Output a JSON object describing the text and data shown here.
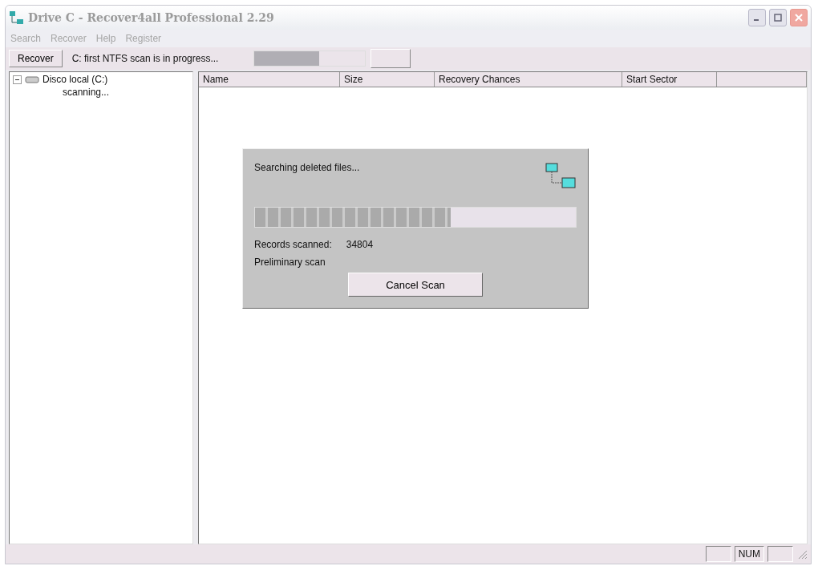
{
  "window": {
    "title": "Drive C  - Recover4all Professional 2.29"
  },
  "menu": [
    {
      "label": "Search",
      "disabled": true
    },
    {
      "label": "Recover",
      "disabled": true
    },
    {
      "label": "Help",
      "disabled": true
    },
    {
      "label": "Register",
      "disabled": true
    }
  ],
  "toolbar": {
    "button": "Recover",
    "status": "C: first NTFS scan is in progress...",
    "level": 0.59
  },
  "tree": [
    {
      "label": "Disco local (C:)",
      "expanded": true,
      "children": [
        {
          "label": "scanning..."
        }
      ]
    }
  ],
  "table": {
    "columns": [
      "Name",
      "Size",
      "Recovery Chances",
      "Start Sector"
    ]
  },
  "dialog": {
    "message": "Searching deleted files...",
    "level": 0.61,
    "records_label": "Records scanned:",
    "records_value": "34804",
    "phase": "Preliminary scan",
    "button": "Cancel Scan"
  },
  "status_bar": {
    "indicator": "NUM"
  }
}
